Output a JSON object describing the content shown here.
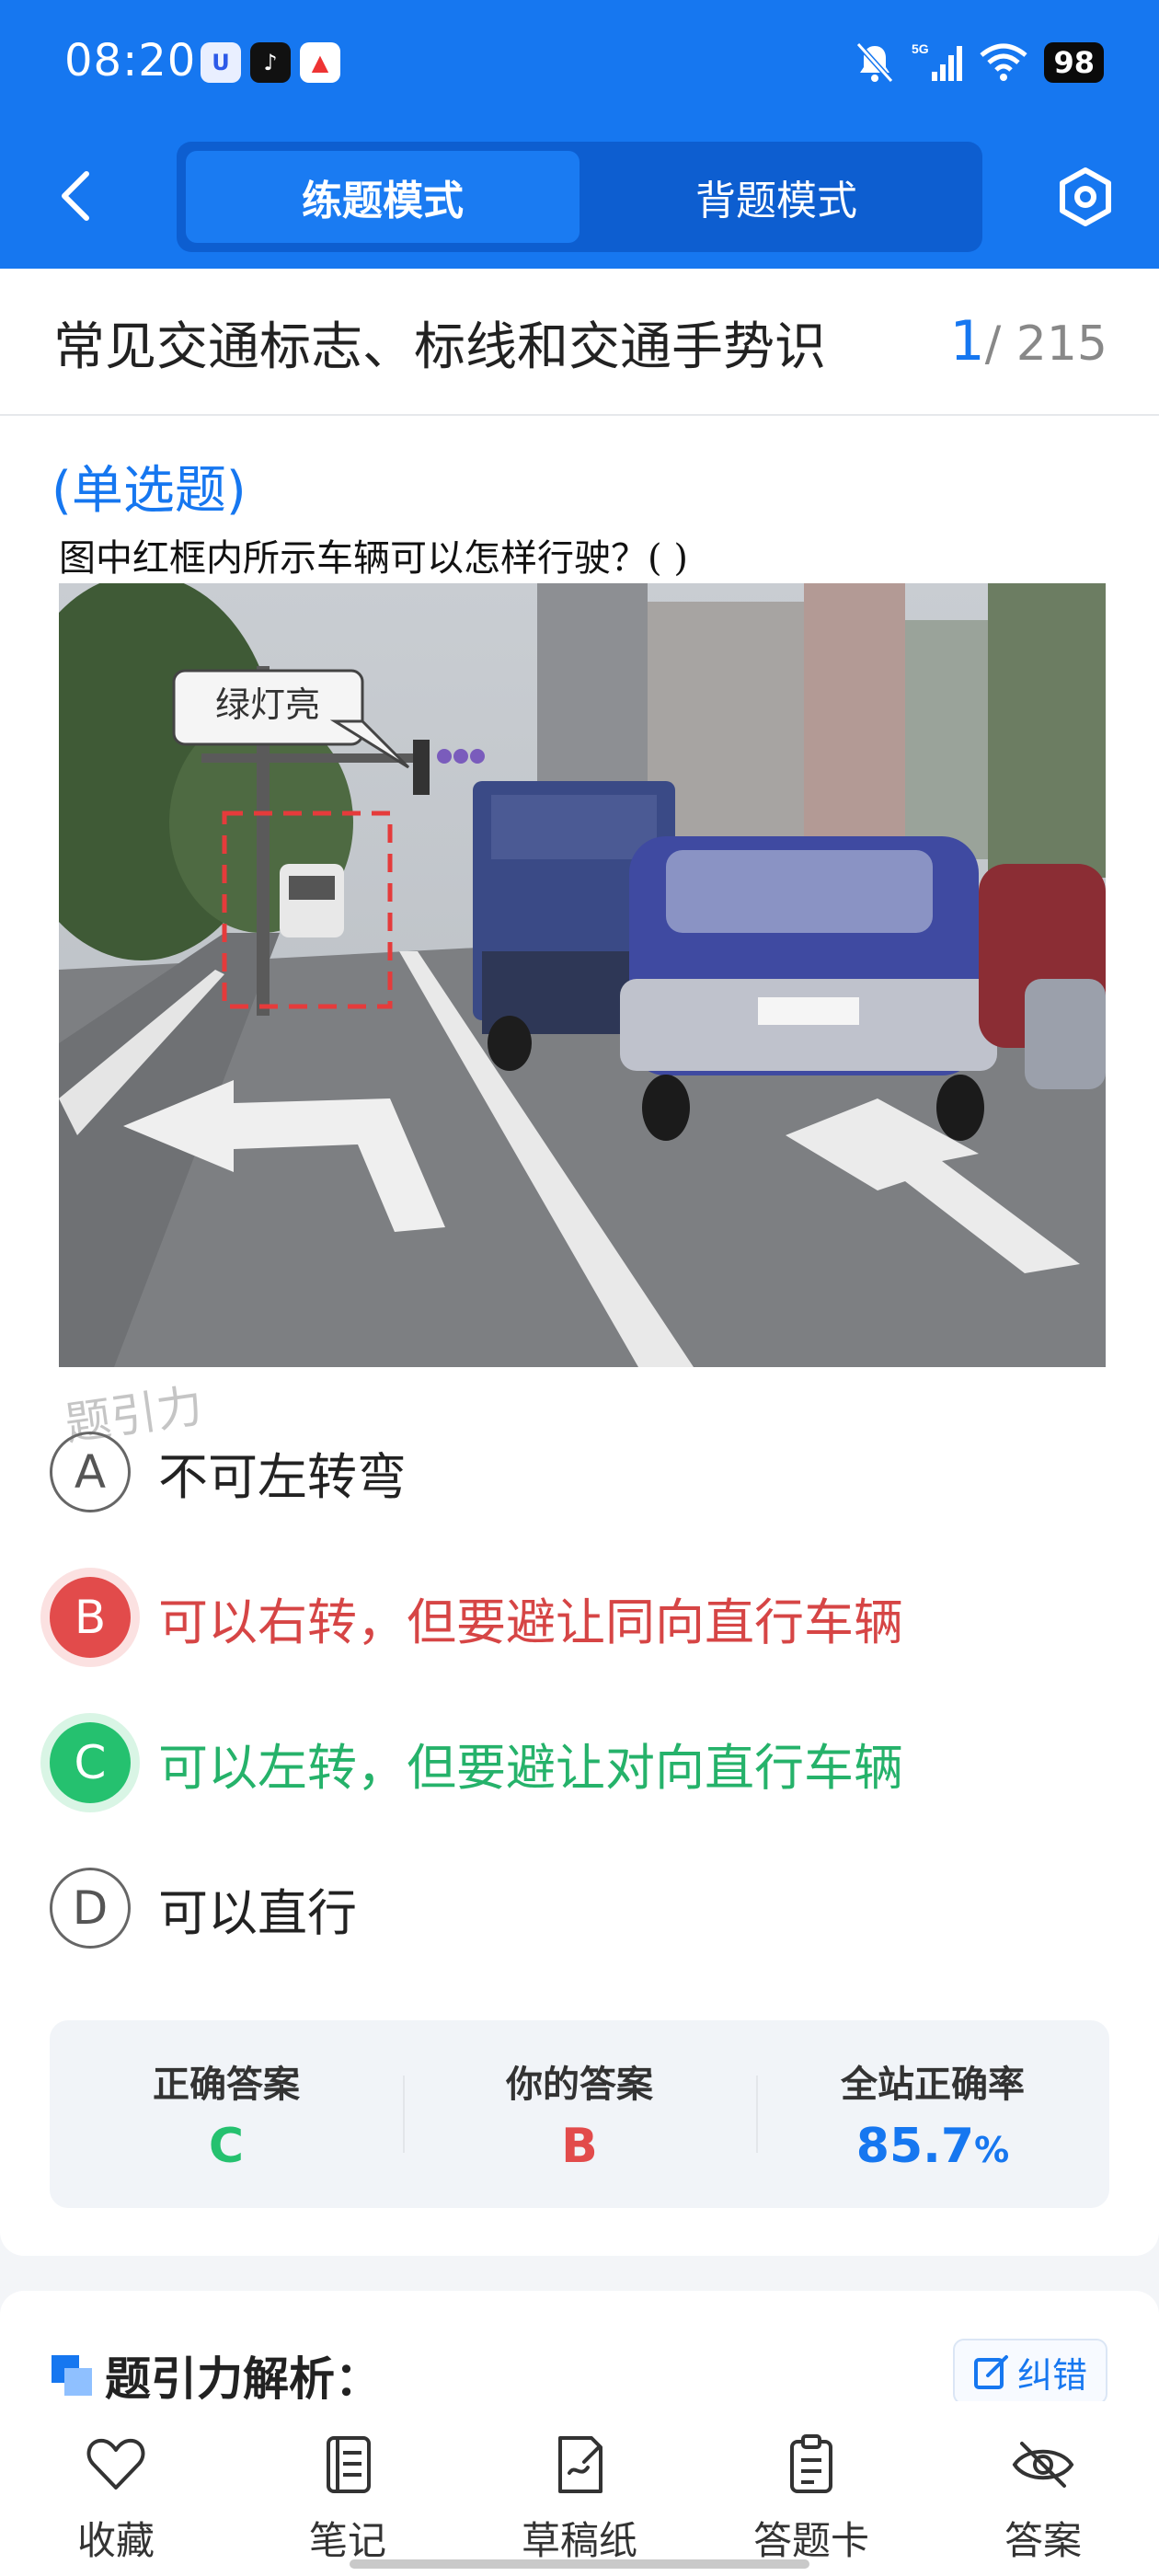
{
  "status": {
    "time": "08:20",
    "battery": "98",
    "network": "5G",
    "app_icons": [
      "u-app-icon",
      "tiktok-icon",
      "a-app-icon"
    ]
  },
  "nav": {
    "tabs": [
      {
        "label": "练题模式",
        "active": true
      },
      {
        "label": "背题模式",
        "active": false
      }
    ]
  },
  "chapter": {
    "title": "常见交通标志、标线和交通手势识",
    "current": "1",
    "total": "/ 215"
  },
  "question": {
    "type": "(单选题)",
    "text": "图中红框内所示车辆可以怎样行驶？(    )",
    "image": {
      "callout": "绿灯亮"
    },
    "watermark": "题引力"
  },
  "options": [
    {
      "letter": "A",
      "text": "不可左转弯",
      "state": "normal"
    },
    {
      "letter": "B",
      "text": "可以右转，但要避让同向直行车辆",
      "state": "wrong"
    },
    {
      "letter": "C",
      "text": "可以左转，但要避让对向直行车辆",
      "state": "right"
    },
    {
      "letter": "D",
      "text": "可以直行",
      "state": "normal"
    }
  ],
  "stats": {
    "correct_label": "正确答案",
    "correct_value": "C",
    "yours_label": "你的答案",
    "yours_value": "B",
    "rate_label": "全站正确率",
    "rate_value": "85.7",
    "rate_unit": "%"
  },
  "analysis": {
    "title": "题引力解析：",
    "report_label": "纠错"
  },
  "bottom_nav": [
    {
      "icon": "heart-icon",
      "label": "收藏"
    },
    {
      "icon": "notebook-icon",
      "label": "笔记"
    },
    {
      "icon": "draft-icon",
      "label": "草稿纸"
    },
    {
      "icon": "answer-card-icon",
      "label": "答题卡"
    },
    {
      "icon": "eye-off-icon",
      "label": "答案"
    }
  ],
  "colors": {
    "primary": "#1677f0",
    "correct": "#25c16f",
    "wrong": "#e24b4b"
  }
}
